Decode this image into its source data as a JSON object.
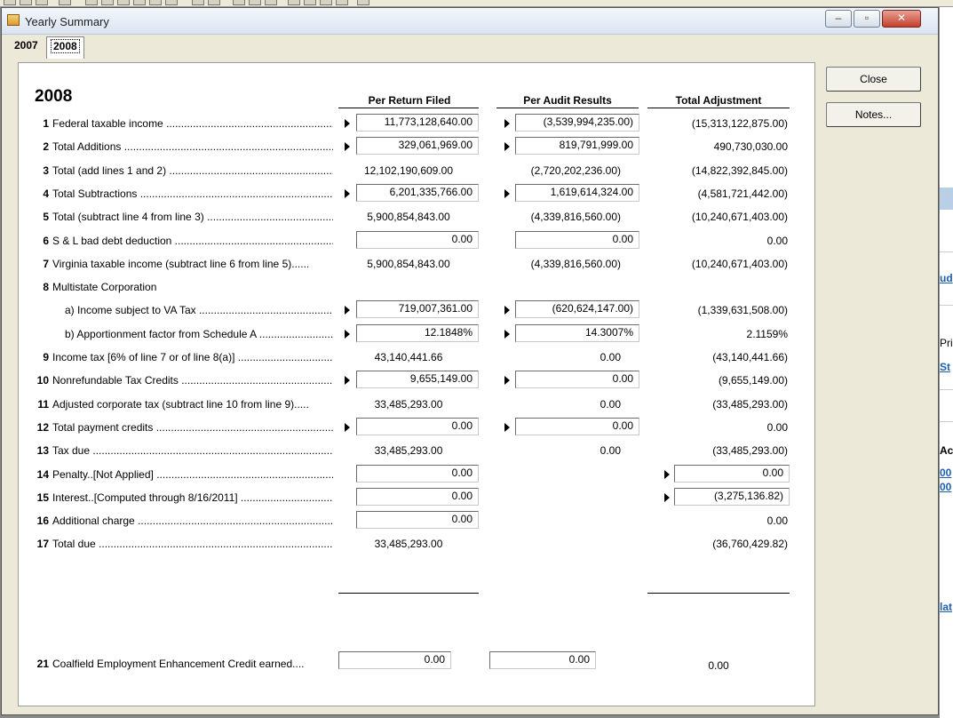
{
  "window": {
    "title": "Yearly Summary",
    "tabs": [
      {
        "label": "2007",
        "active": false
      },
      {
        "label": "2008",
        "active": true
      }
    ]
  },
  "side_buttons": {
    "close_label": "Close",
    "notes_label": "Notes..."
  },
  "summary": {
    "year": "2008",
    "columns": {
      "filed": "Per Return Filed",
      "audit": "Per Audit Results",
      "adjust": "Total Adjustment"
    },
    "rows": [
      {
        "num": "1",
        "label": "Federal taxable income",
        "leader": true,
        "filed": "11,773,128,640.00",
        "filed_input": true,
        "filed_arrow": true,
        "audit": "(3,539,994,235.00)",
        "audit_input": true,
        "audit_arrow": true,
        "adjust": "(15,313,122,875.00)"
      },
      {
        "num": "2",
        "label": "Total  Additions",
        "leader": true,
        "filed": "329,061,969.00",
        "filed_input": true,
        "filed_arrow": true,
        "audit": "819,791,999.00",
        "audit_input": true,
        "audit_arrow": true,
        "adjust": "490,730,030.00"
      },
      {
        "num": "3",
        "label": "Total (add lines 1 and 2)",
        "leader": true,
        "filed": "12,102,190,609.00",
        "audit": "(2,720,202,236.00)",
        "adjust": "(14,822,392,845.00)"
      },
      {
        "num": "4",
        "label": "Total Subtractions ",
        "leader": true,
        "filed": "6,201,335,766.00",
        "filed_input": true,
        "filed_arrow": true,
        "audit": "1,619,614,324.00",
        "audit_input": true,
        "audit_arrow": true,
        "adjust": "(4,581,721,442.00)"
      },
      {
        "num": "5",
        "label": "Total (subtract line 4 from line 3)",
        "leader": true,
        "filed": "5,900,854,843.00",
        "audit": "(4,339,816,560.00)",
        "adjust": "(10,240,671,403.00)"
      },
      {
        "num": "6",
        "label": "S & L bad debt deduction",
        "leader": true,
        "filed": "0.00",
        "filed_input": true,
        "audit": "0.00",
        "audit_input": true,
        "adjust": "0.00"
      },
      {
        "num": "7",
        "label": "Virginia taxable income (subtract line 6 from line 5)......",
        "leader": false,
        "filed": "5,900,854,843.00",
        "audit": "(4,339,816,560.00)",
        "adjust": "(10,240,671,403.00)"
      },
      {
        "num": "8",
        "label": "Multistate Corporation",
        "leader": false,
        "filed": "",
        "audit": "",
        "adjust": ""
      },
      {
        "num": "",
        "label": "a) Income subject to VA Tax",
        "indent": true,
        "leader": true,
        "filed": "719,007,361.00",
        "filed_input": true,
        "filed_arrow": true,
        "audit": "(620,624,147.00)",
        "audit_input": true,
        "audit_arrow": true,
        "adjust": "(1,339,631,508.00)"
      },
      {
        "num": "",
        "label": "b) Apportionment factor from Schedule A",
        "indent": true,
        "leader": true,
        "filed": "12.1848%",
        "filed_input": true,
        "filed_arrow": true,
        "audit": "14.3007%",
        "audit_input": true,
        "audit_arrow": true,
        "adjust": "2.1159%"
      },
      {
        "num": "9",
        "label": "Income tax [6% of line 7 or of line 8(a)]",
        "leader": true,
        "filed": "43,140,441.66",
        "audit": "0.00",
        "adjust": "(43,140,441.66)"
      },
      {
        "num": "10",
        "label": "Nonrefundable Tax Credits",
        "leader": true,
        "filed": "9,655,149.00",
        "filed_input": true,
        "filed_arrow": true,
        "audit": "0.00",
        "audit_input": true,
        "audit_arrow": true,
        "adjust": "(9,655,149.00)"
      },
      {
        "num": "11",
        "label": "Adjusted corporate tax (subtract line 10 from line 9).....",
        "leader": false,
        "filed": "33,485,293.00",
        "audit": "0.00",
        "adjust": "(33,485,293.00)"
      },
      {
        "num": "12",
        "label": "Total payment credits",
        "leader": true,
        "filed": "0.00",
        "filed_input": true,
        "filed_arrow": true,
        "audit": "0.00",
        "audit_input": true,
        "audit_arrow": true,
        "adjust": "0.00"
      },
      {
        "num": "13",
        "label": "Tax due ",
        "leader": true,
        "filed": "33,485,293.00",
        "audit": "0.00",
        "adjust": "(33,485,293.00)"
      },
      {
        "num": "14",
        "label": "Penalty..[Not Applied]",
        "leader": true,
        "filed": "0.00",
        "filed_input": true,
        "audit": "",
        "adjust": "0.00",
        "adjust_input": true,
        "adjust_arrow": true
      },
      {
        "num": "15",
        "label": "Interest..[Computed through 8/16/2011]",
        "leader": true,
        "filed": "0.00",
        "filed_input": true,
        "audit": "",
        "adjust": "(3,275,136.82)",
        "adjust_input": true,
        "adjust_arrow": true
      },
      {
        "num": "16",
        "label": "Additional charge ",
        "leader": true,
        "filed": "0.00",
        "filed_input": true,
        "audit": "",
        "adjust": "0.00"
      },
      {
        "num": "17",
        "label": "Total due ",
        "leader": true,
        "filed": "33,485,293.00",
        "audit": "",
        "adjust": "(36,760,429.82)"
      }
    ],
    "credit_row": {
      "num": "21",
      "label": "Coalfield Employment Enhancement Credit earned....",
      "filed": "0.00",
      "audit": "0.00",
      "adjust": "0.00"
    }
  },
  "background_window": {
    "fragments": [
      "ud",
      "Pri",
      "St",
      "Ac",
      "00",
      "00",
      "lat"
    ]
  }
}
